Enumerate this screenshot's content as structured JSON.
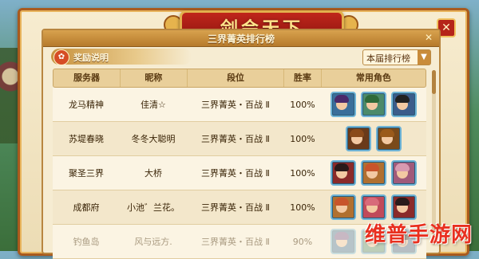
{
  "window": {
    "title": "剑会天下",
    "close_glyph": "✕"
  },
  "panel": {
    "title": "三界菁英排行榜",
    "close_glyph": "✕"
  },
  "reward": {
    "label": "奖励说明",
    "icon": "gift-icon",
    "icon_glyph": "✿"
  },
  "season_dropdown": {
    "label": "本届排行榜",
    "arrow": "▼"
  },
  "table": {
    "headers": [
      "服务器",
      "昵称",
      "段位",
      "胜率",
      "常用角色"
    ],
    "rows": [
      {
        "server": "龙马精神",
        "name": "佳清☆",
        "rank": "三界菁英・百战 Ⅱ",
        "winrate": "100%",
        "roles": [
          {
            "hair": "#4a2a6a",
            "bg": "#3a6e9a"
          },
          {
            "hair": "#2f6a3a",
            "bg": "#4c8a6a"
          },
          {
            "hair": "#222",
            "bg": "#3b5c8a"
          }
        ]
      },
      {
        "server": "苏堤春晓",
        "name": "冬冬大聪明",
        "rank": "三界菁英・百战 Ⅱ",
        "winrate": "100%",
        "roles": [
          {
            "hair": "#8a4a1a",
            "bg": "#6a3a1a"
          },
          {
            "hair": "#9a5a1a",
            "bg": "#7a4a1a"
          }
        ]
      },
      {
        "server": "聚圣三界",
        "name": "大桥",
        "rank": "三界菁英・百战 Ⅱ",
        "winrate": "100%",
        "roles": [
          {
            "hair": "#2a1a1a",
            "bg": "#8a2a2a"
          },
          {
            "hair": "#c8542a",
            "bg": "#b07030"
          },
          {
            "hair": "#d89ab0",
            "bg": "#a05a7a"
          }
        ]
      },
      {
        "server": "成都府",
        "name": "小池゛兰花。",
        "rank": "三界菁英・百战 Ⅱ",
        "winrate": "100%",
        "roles": [
          {
            "hair": "#c8542a",
            "bg": "#b07030"
          },
          {
            "hair": "#d86a7a",
            "bg": "#c04a5a"
          },
          {
            "hair": "#2a1a1a",
            "bg": "#8a2a2a"
          }
        ]
      },
      {
        "server": "钓鱼岛",
        "name": "风与远方.",
        "rank": "三界菁英・百战 Ⅱ",
        "winrate": "90%",
        "roles": [
          {
            "hair": "#6a4a8a",
            "bg": "#3a6e9a"
          },
          {
            "hair": "#2f6a3a",
            "bg": "#4c8a6a"
          },
          {
            "hair": "#222",
            "bg": "#3b5c8a"
          }
        ]
      }
    ]
  },
  "watermark": "维普手游网"
}
